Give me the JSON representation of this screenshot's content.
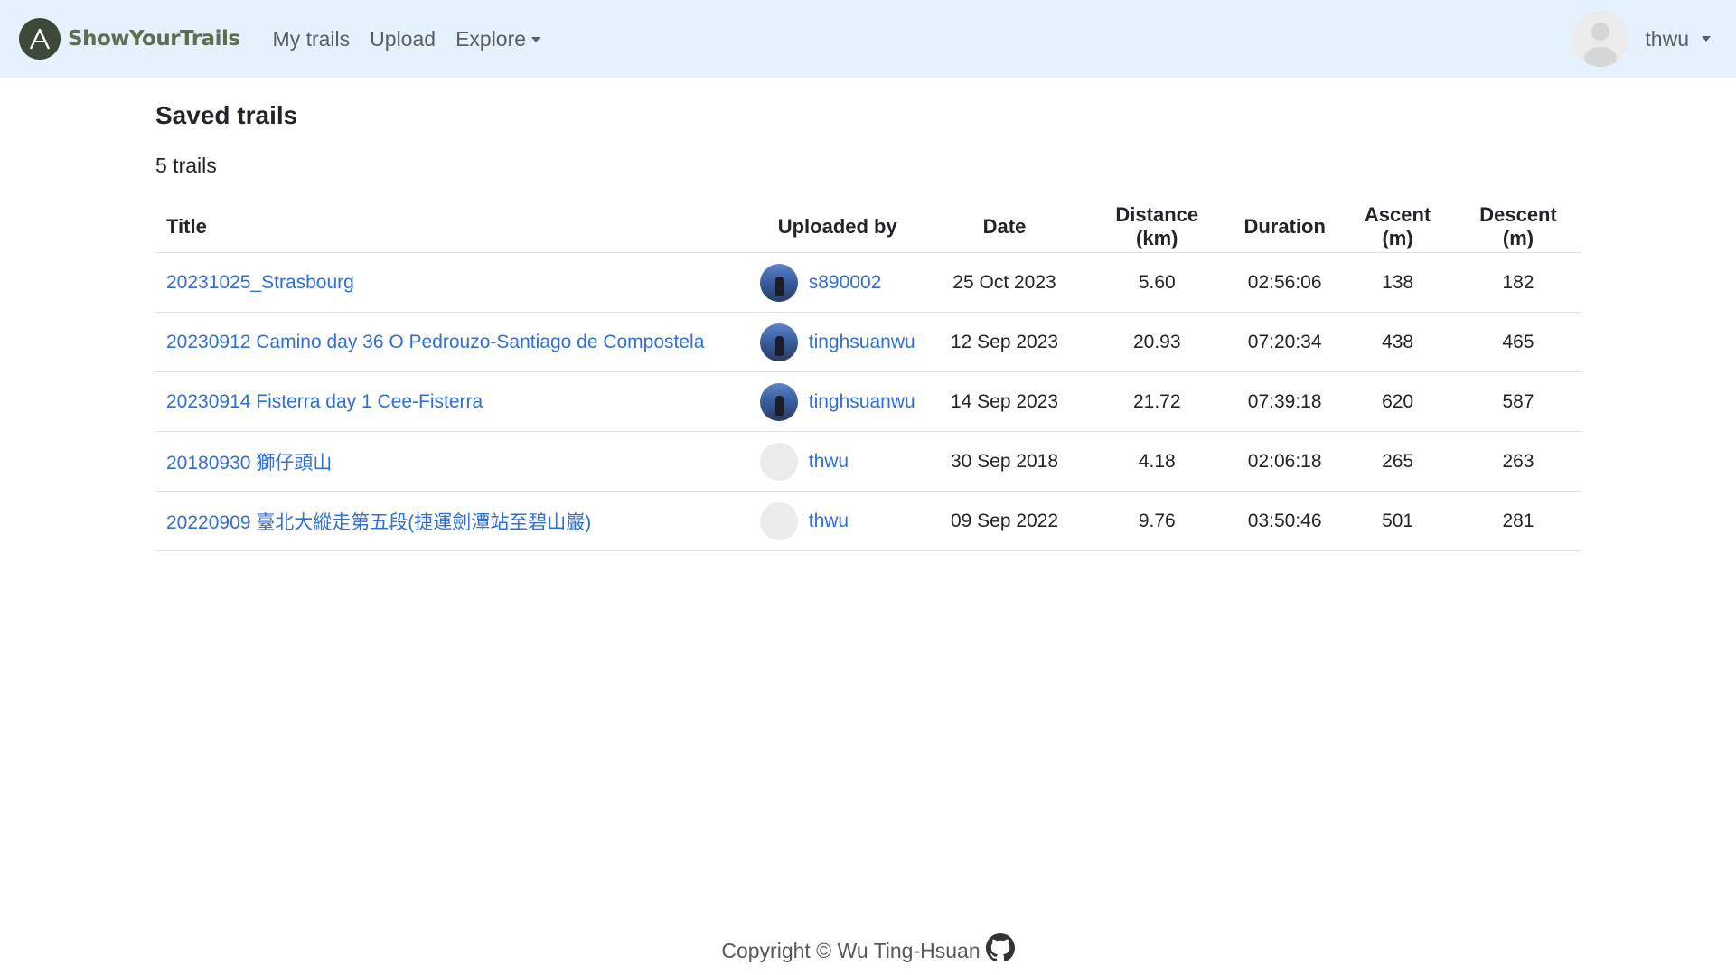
{
  "brand": {
    "name": "ShowYourTrails",
    "logo_icon": "mountain-logo-icon",
    "logo_color": "#3d4a3a",
    "text_color": "#5d6f4e"
  },
  "nav": {
    "items": [
      {
        "label": "My trails"
      },
      {
        "label": "Upload"
      },
      {
        "label": "Explore",
        "dropdown": true
      }
    ]
  },
  "user": {
    "name": "thwu",
    "avatar_icon": "default-avatar-icon"
  },
  "page": {
    "title": "Saved trails",
    "count_text": "5 trails"
  },
  "table": {
    "headers": [
      "Title",
      "Uploaded by",
      "Date",
      "Distance (km)",
      "Duration",
      "Ascent (m)",
      "Descent (m)"
    ],
    "rows": [
      {
        "title": "20231025_Strasbourg",
        "uploader": "s890002",
        "avatar": "photo",
        "date": "25 Oct 2023",
        "distance": "5.60",
        "duration": "02:56:06",
        "ascent": "138",
        "descent": "182"
      },
      {
        "title": "20230912 Camino day 36 O Pedrouzo-Santiago de Compostela",
        "uploader": "tinghsuanwu",
        "avatar": "photo",
        "date": "12 Sep 2023",
        "distance": "20.93",
        "duration": "07:20:34",
        "ascent": "438",
        "descent": "465"
      },
      {
        "title": "20230914 Fisterra day 1 Cee-Fisterra",
        "uploader": "tinghsuanwu",
        "avatar": "photo",
        "date": "14 Sep 2023",
        "distance": "21.72",
        "duration": "07:39:18",
        "ascent": "620",
        "descent": "587"
      },
      {
        "title": "20180930 獅仔頭山",
        "uploader": "thwu",
        "avatar": "blank",
        "date": "30 Sep 2018",
        "distance": "4.18",
        "duration": "02:06:18",
        "ascent": "265",
        "descent": "263"
      },
      {
        "title": "20220909 臺北大縱走第五段(捷運劍潭站至碧山巖)",
        "uploader": "thwu",
        "avatar": "blank",
        "date": "09 Sep 2022",
        "distance": "9.76",
        "duration": "03:50:46",
        "ascent": "501",
        "descent": "281"
      }
    ]
  },
  "footer": {
    "text": "Copyright © Wu Ting-Hsuan",
    "icon": "github-icon"
  },
  "colors": {
    "navbar_bg": "#e3f2fd",
    "link": "#2f6fd6"
  }
}
